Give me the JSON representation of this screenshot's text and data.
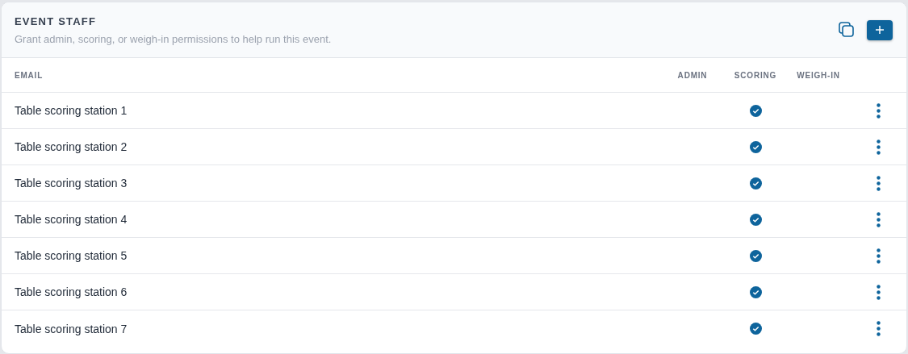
{
  "header": {
    "title": "EVENT STAFF",
    "subtitle": "Grant admin, scoring, or weigh-in permissions to help run this event."
  },
  "table": {
    "columns": [
      "EMAIL",
      "ADMIN",
      "SCORING",
      "WEIGH-IN"
    ],
    "rows": [
      {
        "email": "Table scoring station 1",
        "admin": false,
        "scoring": true,
        "weigh_in": false
      },
      {
        "email": "Table scoring station 2",
        "admin": false,
        "scoring": true,
        "weigh_in": false
      },
      {
        "email": "Table scoring station 3",
        "admin": false,
        "scoring": true,
        "weigh_in": false
      },
      {
        "email": "Table scoring station 4",
        "admin": false,
        "scoring": true,
        "weigh_in": false
      },
      {
        "email": "Table scoring station 5",
        "admin": false,
        "scoring": true,
        "weigh_in": false
      },
      {
        "email": "Table scoring station 6",
        "admin": false,
        "scoring": true,
        "weigh_in": false
      },
      {
        "email": "Table scoring station 7",
        "admin": false,
        "scoring": true,
        "weigh_in": false
      }
    ]
  }
}
